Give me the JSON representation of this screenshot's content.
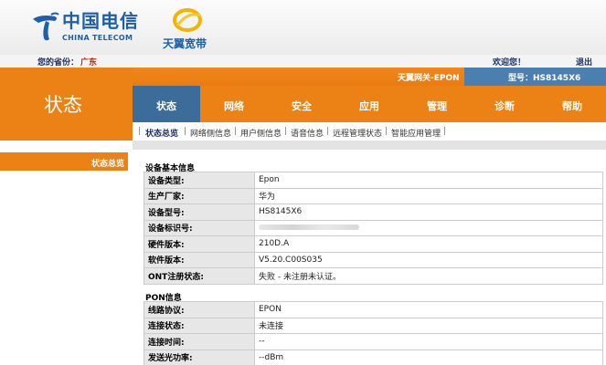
{
  "brand": {
    "logo_cn": "中国电信",
    "logo_en": "CHINA TELECOM",
    "tianyi": "天翼宽带"
  },
  "province": {
    "label": "您的省份：",
    "value": "广东"
  },
  "user": {
    "welcome": "欢迎您！",
    "logout": "退出"
  },
  "sidebar_title": "状态",
  "device": {
    "name": "天翼网关-EPON",
    "model_label": "型号：HS8145X6"
  },
  "tabs": [
    {
      "label": "状态"
    },
    {
      "label": "网络"
    },
    {
      "label": "安全"
    },
    {
      "label": "应用"
    },
    {
      "label": "管理"
    },
    {
      "label": "诊断"
    },
    {
      "label": "帮助"
    }
  ],
  "subnav": [
    {
      "label": "状态总览"
    },
    {
      "label": "网络侧信息"
    },
    {
      "label": "用户侧信息"
    },
    {
      "label": "语音信息"
    },
    {
      "label": "远程管理状态"
    },
    {
      "label": "智能应用管理"
    }
  ],
  "left_menu": {
    "item": "状态总览"
  },
  "sections": {
    "device_info": {
      "title": "设备基本信息",
      "rows": [
        {
          "key": "设备类型:",
          "value": "Epon"
        },
        {
          "key": "生产厂家:",
          "value": "华为"
        },
        {
          "key": "设备型号:",
          "value": "HS8145X6"
        },
        {
          "key": "设备标识号:",
          "value": ""
        },
        {
          "key": "硬件版本:",
          "value": "210D.A"
        },
        {
          "key": "软件版本:",
          "value": "V5.20.C00S035"
        },
        {
          "key": "ONT注册状态:",
          "value": "失败 - 未注册未认证。"
        }
      ]
    },
    "pon_info": {
      "title": "PON信息",
      "rows": [
        {
          "key": "线路协议:",
          "value": "EPON"
        },
        {
          "key": "连接状态:",
          "value": "未连接"
        },
        {
          "key": "连接时间:",
          "value": "--"
        },
        {
          "key": "发送光功率:",
          "value": "--dBm"
        }
      ]
    }
  },
  "colors": {
    "orange": "#ec8215",
    "blue_active": "#3b6c9a",
    "model_blue": "#4a7fb0"
  }
}
